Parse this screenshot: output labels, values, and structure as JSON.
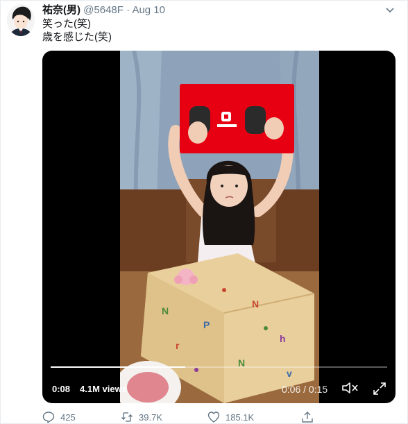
{
  "tweet": {
    "name": "祐奈(男)",
    "handle": "@5648F",
    "separator": "·",
    "date": "Aug 10",
    "lines": [
      "笑った(笑)",
      "歳を感じた(笑)"
    ]
  },
  "video": {
    "time_elapsed": "0:08",
    "view_count": "4.1M views",
    "time_position": "0:06 / 0:15",
    "progress": 0.4
  },
  "actions": {
    "reply_count": "425",
    "retweet_count": "39.7K",
    "like_count": "185.1K"
  },
  "icons": {
    "reply": "reply-icon",
    "retweet": "retweet-icon",
    "like": "heart-icon",
    "share": "share-icon",
    "caret": "chevron-down-icon",
    "mute": "speaker-muted-icon",
    "fullscreen": "fullscreen-icon"
  },
  "colors": {
    "text": "#14171a",
    "secondary": "#657786",
    "switch_red": "#e60012"
  }
}
